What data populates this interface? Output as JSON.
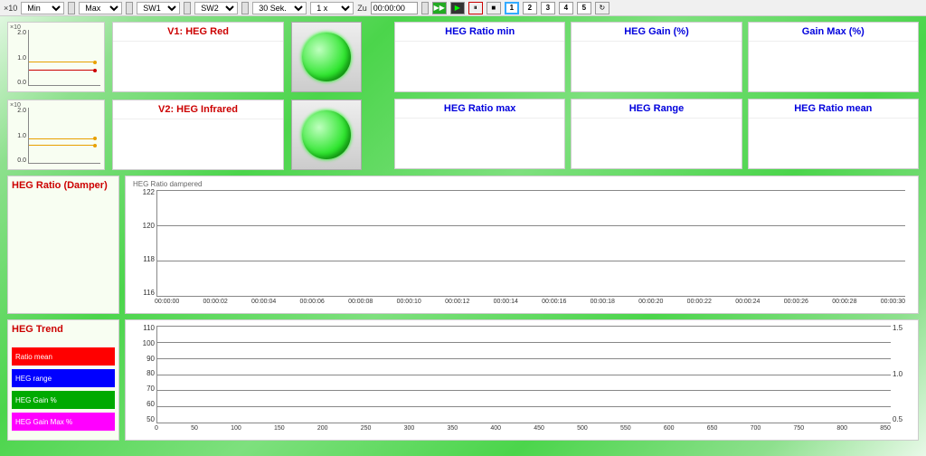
{
  "toolbar": {
    "exp_label": "×10",
    "min": "Min",
    "max": "Max",
    "sw1": "SW1",
    "sw2": "SW2",
    "duration": "30 Sek.",
    "speed": "1 x",
    "zu": "Zu",
    "time": "00:00:00",
    "nums": [
      "1",
      "2",
      "3",
      "4",
      "5"
    ]
  },
  "sparklines": {
    "exponent": "×10",
    "ticks": [
      "2.0",
      "1.0",
      "0.0"
    ]
  },
  "channels": {
    "v1": "V1: HEG Red",
    "v2": "V2: HEG Infrared"
  },
  "metrics": {
    "r1c1": "HEG Ratio min",
    "r1c2": "HEG Gain (%)",
    "r1c3": "Gain Max (%)",
    "r2c1": "HEG Ratio max",
    "r2c2": "HEG Range",
    "r2c3": "HEG Ratio mean"
  },
  "damper": {
    "side_title": "HEG Ratio (Damper)",
    "chart_title": "HEG Ratio dampered"
  },
  "trend": {
    "side_title": "HEG Trend",
    "legend": {
      "ratio_mean": "Ratio mean",
      "heg_range": "HEG range",
      "heg_gain": "HEG Gain %",
      "heg_gain_max": "HEG Gain Max %"
    }
  },
  "chart_data": [
    {
      "type": "line",
      "title": "HEG Ratio dampered",
      "y_ticks": [
        116,
        118,
        120,
        122
      ],
      "x_ticks": [
        "00:00:00",
        "00:00:02",
        "00:00:04",
        "00:00:06",
        "00:00:08",
        "00:00:10",
        "00:00:12",
        "00:00:14",
        "00:00:16",
        "00:00:18",
        "00:00:20",
        "00:00:22",
        "00:00:24",
        "00:00:26",
        "00:00:28",
        "00:00:30"
      ],
      "ylim": [
        115,
        123
      ],
      "series": []
    },
    {
      "type": "line",
      "title": "HEG Trend",
      "y_ticks_left": [
        50,
        60,
        70,
        80,
        90,
        100,
        110
      ],
      "y_ticks_right": [
        0.5,
        1.0,
        1.5
      ],
      "x_ticks": [
        0,
        50,
        100,
        150,
        200,
        250,
        300,
        350,
        400,
        450,
        500,
        550,
        600,
        650,
        700,
        750,
        800,
        850
      ],
      "ylim": [
        40,
        115
      ],
      "series": [
        {
          "name": "Ratio mean",
          "color": "#f00",
          "values": []
        },
        {
          "name": "HEG range",
          "color": "#00f",
          "values": []
        },
        {
          "name": "HEG Gain %",
          "color": "#0a0",
          "values": []
        },
        {
          "name": "HEG Gain Max %",
          "color": "#f0f",
          "values": []
        }
      ]
    }
  ]
}
